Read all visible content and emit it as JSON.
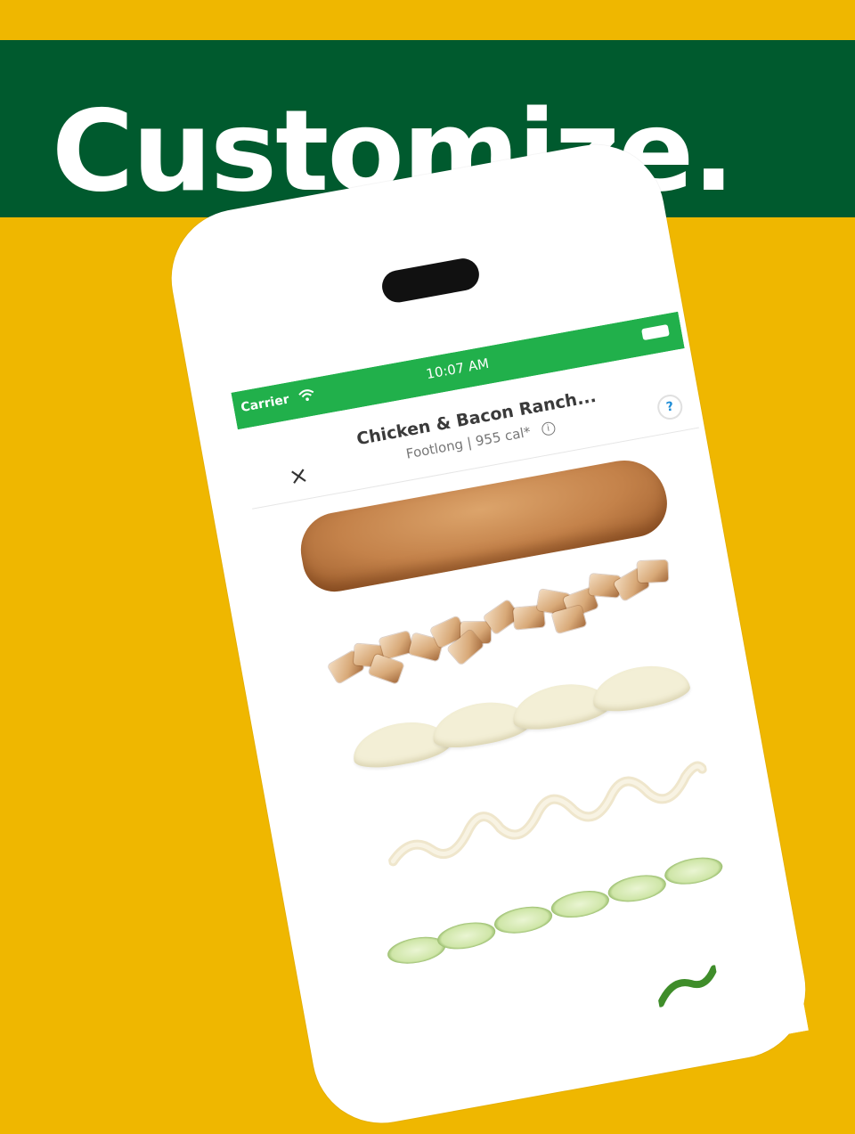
{
  "banner": {
    "title": "Customize."
  },
  "status_bar": {
    "carrier": "Carrier",
    "time": "10:07 AM"
  },
  "header": {
    "close_icon": "×",
    "title": "Chicken & Bacon Ranch...",
    "subtitle": "Footlong | 955 cal*",
    "info_icon": "i",
    "help_icon": "?"
  },
  "colors": {
    "background": "#efb700",
    "banner": "#005a2e",
    "status_bar": "#21b04b",
    "help_accent": "#1d8cd6"
  },
  "ingredients": [
    "bread-icon",
    "chicken-icon",
    "cheese-icon",
    "sauce-icon",
    "cucumber-icon",
    "pepper-icon"
  ]
}
